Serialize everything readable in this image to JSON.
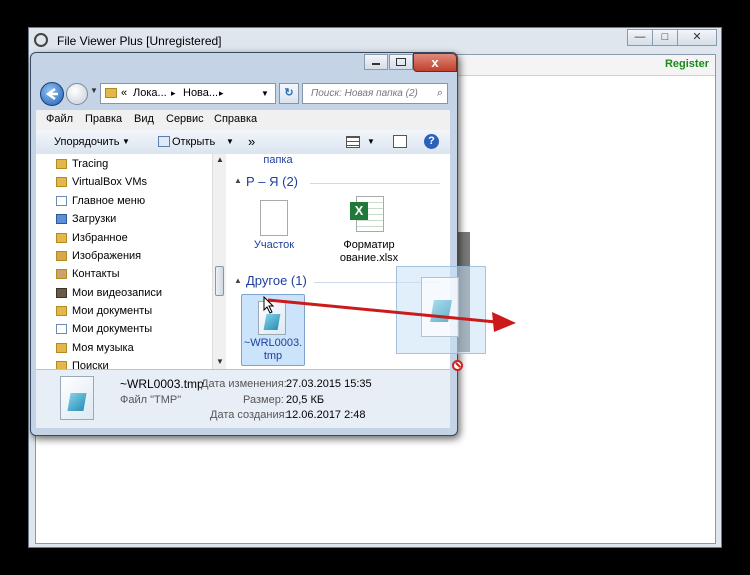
{
  "background_app": {
    "title": "File Viewer Plus [Unregistered]",
    "register_label": "Register",
    "minimize_glyph": "—",
    "maximize_glyph": "□",
    "close_glyph": "✕"
  },
  "explorer": {
    "close_glyph": "x",
    "address": {
      "separator": "«",
      "crumb1": "Лока...",
      "arrow1": "▸",
      "crumb2": "Нова...",
      "arrow2": "▸"
    },
    "search_placeholder": "Поиск: Новая папка (2)",
    "menu": [
      "Файл",
      "Правка",
      "Вид",
      "Сервис",
      "Справка"
    ],
    "toolbar": {
      "organize": "Упорядочить",
      "open": "Открыть",
      "more": "»"
    },
    "nav_items": [
      "Tracing",
      "VirtualBox VMs",
      "Главное меню",
      "Загрузки",
      "Избранное",
      "Изображения",
      "Контакты",
      "Мои видеозаписи",
      "Мои документы",
      "Мои документы",
      "Моя музыка",
      "Поиски"
    ],
    "content": {
      "top_partial_label": "папка",
      "group1": "Р – Я (2)",
      "group1_files": [
        {
          "name": "Участок",
          "icon": "text-document-icon"
        },
        {
          "name_line1": "Форматир",
          "name_line2": "ование.xlsx",
          "icon": "excel-file-icon"
        }
      ],
      "group2": "Другое (1)",
      "selected_file": {
        "line1": "~WRL0003.",
        "line2": "tmp",
        "icon": "tmp-file-icon"
      }
    },
    "details": {
      "filename": "~WRL0003.tmp",
      "filetype": "Файл \"TMP\"",
      "modified_label": "Дата изменения:",
      "modified_value": "27.03.2015 15:35",
      "size_label": "Размер:",
      "size_value": "20,5 КБ",
      "created_label": "Дата создания:",
      "created_value": "12.06.2017 2:48"
    }
  },
  "colors": {
    "register": "#1a8a1a",
    "arrow": "#cc1a1a",
    "group_heading": "#1e3f9c",
    "selection": "#cce4fb"
  }
}
